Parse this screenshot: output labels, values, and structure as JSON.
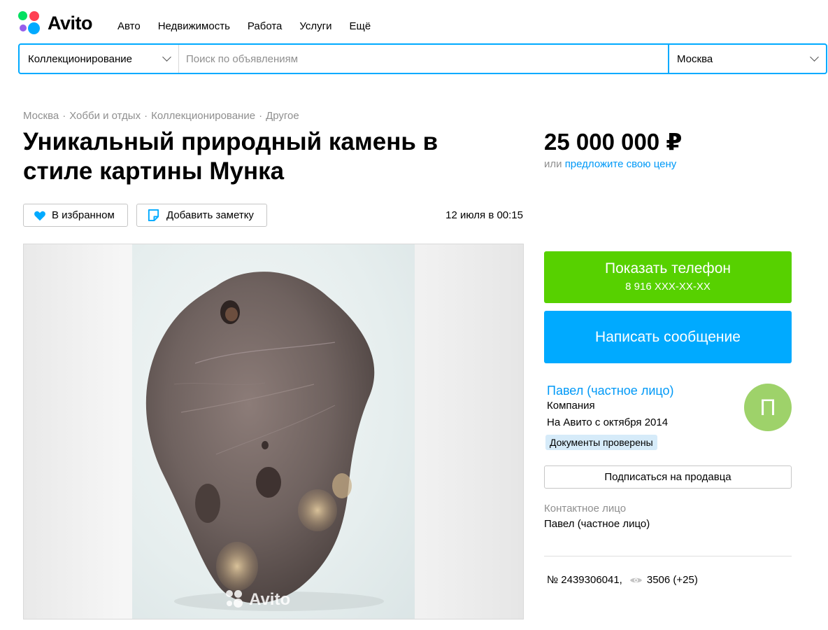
{
  "header": {
    "logo_text": "Avito",
    "nav": [
      "Авто",
      "Недвижимость",
      "Работа",
      "Услуги",
      "Ещё"
    ]
  },
  "search": {
    "category": "Коллекционирование",
    "placeholder": "Поиск по объявлениям",
    "city": "Москва"
  },
  "breadcrumb": [
    "Москва",
    "Хобби и отдых",
    "Коллекционирование",
    "Другое"
  ],
  "breadcrumb_separator": "·",
  "listing": {
    "title": "Уникальный природный камень в стиле картины Мунка",
    "price": "25 000 000 ₽",
    "price_alt_prefix": "или",
    "price_alt_link": "предложите свою цену",
    "favorite_label": "В избранном",
    "note_label": "Добавить заметку",
    "date": "12 июля в 00:15",
    "watermark": "Avito"
  },
  "contact": {
    "phone_label": "Показать телефон",
    "phone_masked": "8 916 XXX-XX-XX",
    "message_label": "Написать сообщение"
  },
  "seller": {
    "name": "Павел (частное лицо)",
    "type": "Компания",
    "since": "На Авито с октября 2014",
    "badge": "Документы проверены",
    "avatar_letter": "П",
    "subscribe_label": "Подписаться на продавца",
    "contact_label": "Контактное лицо",
    "contact_name": "Павел (частное лицо)"
  },
  "meta": {
    "ad_number": "№ 2439306041,",
    "views": "3506 (+25)"
  },
  "colors": {
    "accent_blue": "#00aaff",
    "link_blue": "#0099f7",
    "green": "#57d100",
    "avatar_green": "#9ed26a",
    "badge_bg": "#d6ebf9"
  },
  "icons": [
    "heart-icon",
    "note-icon",
    "chevron-down-icon",
    "eye-icon",
    "avito-logo-icon"
  ]
}
